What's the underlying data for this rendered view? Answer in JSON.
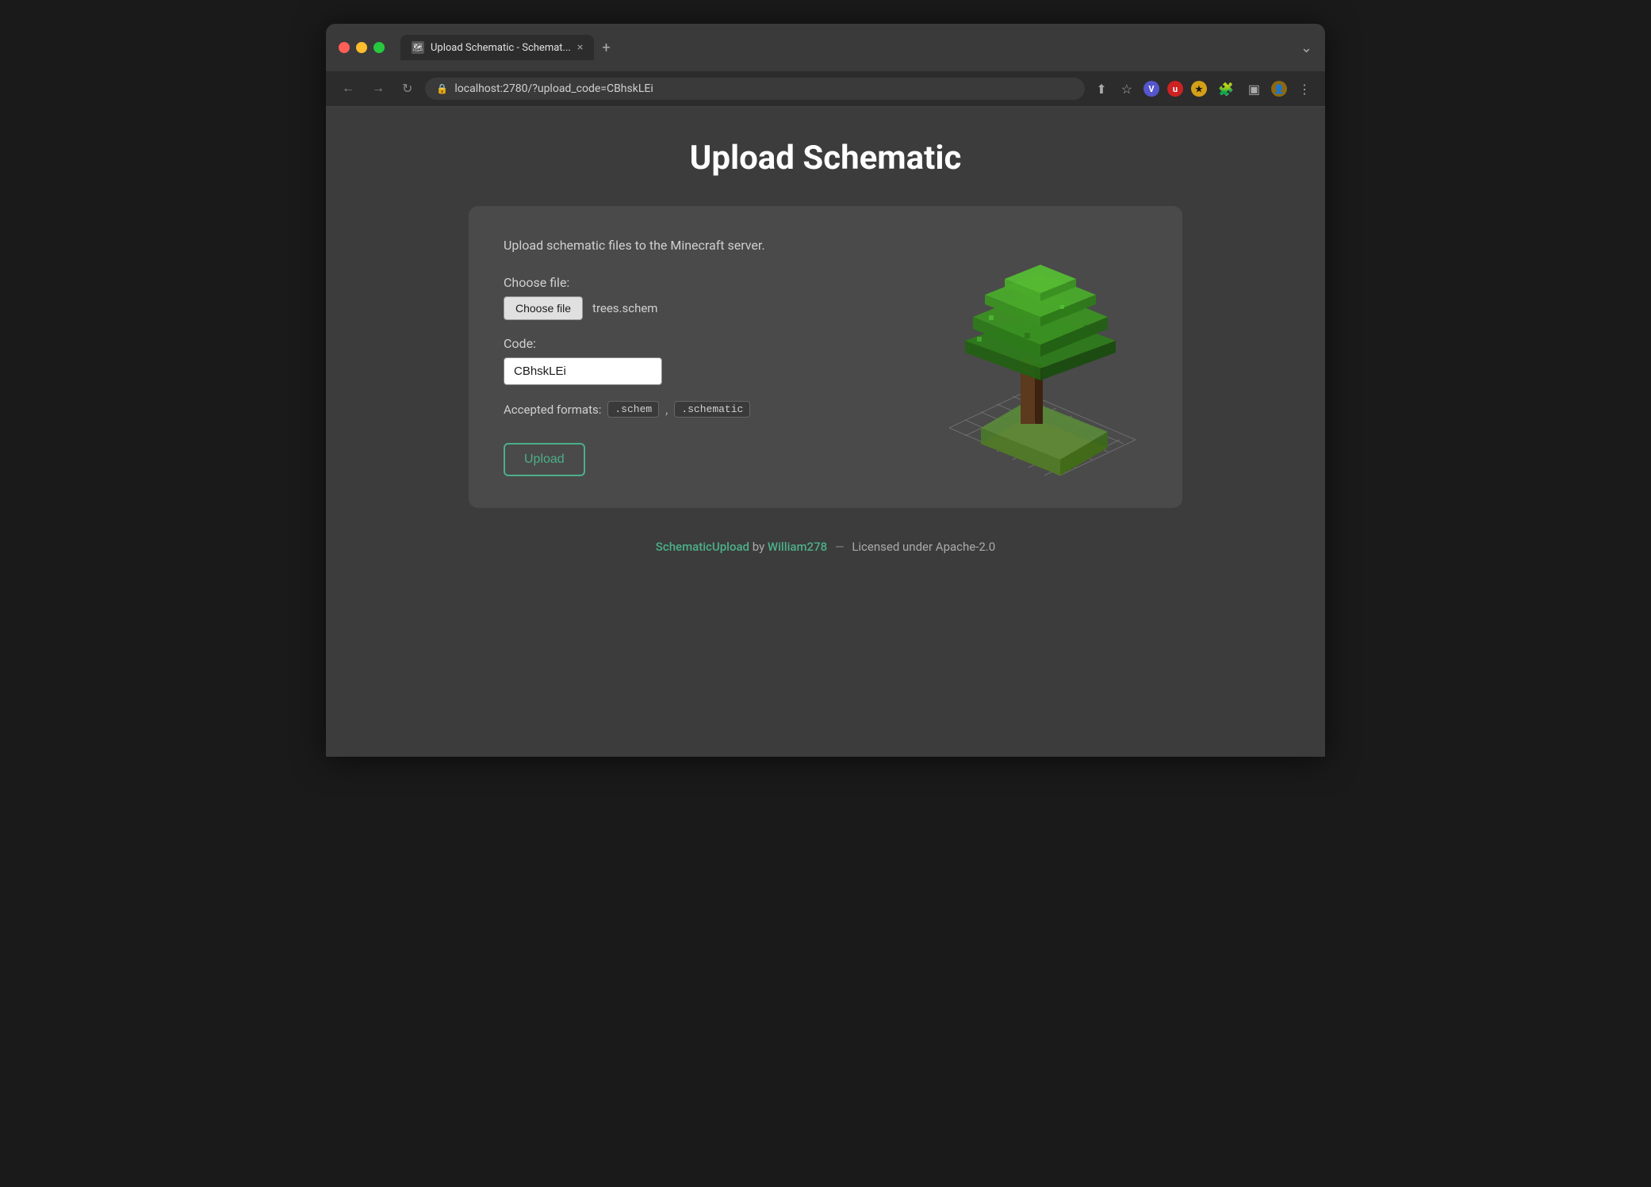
{
  "browser": {
    "tab_title": "Upload Schematic - Schemat...",
    "tab_close": "×",
    "tab_new": "+",
    "tab_menu": "⌄",
    "url": "localhost:2780/?upload_code=CBhskLEi",
    "nav_back": "←",
    "nav_forward": "→",
    "nav_reload": "↻"
  },
  "page": {
    "title": "Upload Schematic",
    "description": "Upload schematic files to the Minecraft server.",
    "choose_file_label": "Choose file:",
    "choose_file_btn": "Choose file",
    "file_name": "trees.schem",
    "code_label": "Code:",
    "code_value": "CBhskLEi",
    "accepted_formats_label": "Accepted formats:",
    "format_1": ".schem",
    "format_2": ".schematic",
    "upload_btn": "Upload"
  },
  "footer": {
    "app_name": "SchematicUpload",
    "by_text": "by",
    "author": "William278",
    "separator": "—",
    "license": "Licensed under Apache-2.0"
  }
}
